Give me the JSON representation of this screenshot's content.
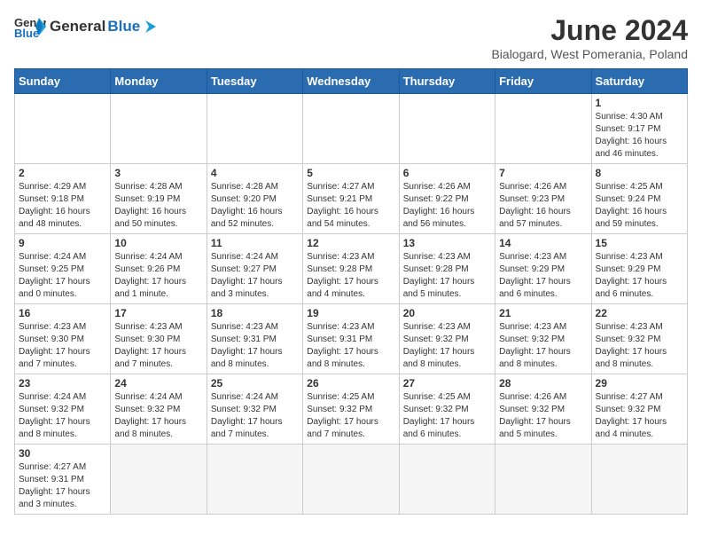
{
  "header": {
    "logo_general": "General",
    "logo_blue": "Blue",
    "month_year": "June 2024",
    "location": "Bialogard, West Pomerania, Poland"
  },
  "days_of_week": [
    "Sunday",
    "Monday",
    "Tuesday",
    "Wednesday",
    "Thursday",
    "Friday",
    "Saturday"
  ],
  "weeks": [
    [
      {
        "date": "",
        "info": ""
      },
      {
        "date": "",
        "info": ""
      },
      {
        "date": "",
        "info": ""
      },
      {
        "date": "",
        "info": ""
      },
      {
        "date": "",
        "info": ""
      },
      {
        "date": "",
        "info": ""
      },
      {
        "date": "1",
        "info": "Sunrise: 4:30 AM\nSunset: 9:17 PM\nDaylight: 16 hours\nand 46 minutes."
      }
    ],
    [
      {
        "date": "2",
        "info": "Sunrise: 4:29 AM\nSunset: 9:18 PM\nDaylight: 16 hours\nand 48 minutes."
      },
      {
        "date": "3",
        "info": "Sunrise: 4:28 AM\nSunset: 9:19 PM\nDaylight: 16 hours\nand 50 minutes."
      },
      {
        "date": "4",
        "info": "Sunrise: 4:28 AM\nSunset: 9:20 PM\nDaylight: 16 hours\nand 52 minutes."
      },
      {
        "date": "5",
        "info": "Sunrise: 4:27 AM\nSunset: 9:21 PM\nDaylight: 16 hours\nand 54 minutes."
      },
      {
        "date": "6",
        "info": "Sunrise: 4:26 AM\nSunset: 9:22 PM\nDaylight: 16 hours\nand 56 minutes."
      },
      {
        "date": "7",
        "info": "Sunrise: 4:26 AM\nSunset: 9:23 PM\nDaylight: 16 hours\nand 57 minutes."
      },
      {
        "date": "8",
        "info": "Sunrise: 4:25 AM\nSunset: 9:24 PM\nDaylight: 16 hours\nand 59 minutes."
      }
    ],
    [
      {
        "date": "9",
        "info": "Sunrise: 4:24 AM\nSunset: 9:25 PM\nDaylight: 17 hours\nand 0 minutes."
      },
      {
        "date": "10",
        "info": "Sunrise: 4:24 AM\nSunset: 9:26 PM\nDaylight: 17 hours\nand 1 minute."
      },
      {
        "date": "11",
        "info": "Sunrise: 4:24 AM\nSunset: 9:27 PM\nDaylight: 17 hours\nand 3 minutes."
      },
      {
        "date": "12",
        "info": "Sunrise: 4:23 AM\nSunset: 9:28 PM\nDaylight: 17 hours\nand 4 minutes."
      },
      {
        "date": "13",
        "info": "Sunrise: 4:23 AM\nSunset: 9:28 PM\nDaylight: 17 hours\nand 5 minutes."
      },
      {
        "date": "14",
        "info": "Sunrise: 4:23 AM\nSunset: 9:29 PM\nDaylight: 17 hours\nand 6 minutes."
      },
      {
        "date": "15",
        "info": "Sunrise: 4:23 AM\nSunset: 9:29 PM\nDaylight: 17 hours\nand 6 minutes."
      }
    ],
    [
      {
        "date": "16",
        "info": "Sunrise: 4:23 AM\nSunset: 9:30 PM\nDaylight: 17 hours\nand 7 minutes."
      },
      {
        "date": "17",
        "info": "Sunrise: 4:23 AM\nSunset: 9:30 PM\nDaylight: 17 hours\nand 7 minutes."
      },
      {
        "date": "18",
        "info": "Sunrise: 4:23 AM\nSunset: 9:31 PM\nDaylight: 17 hours\nand 8 minutes."
      },
      {
        "date": "19",
        "info": "Sunrise: 4:23 AM\nSunset: 9:31 PM\nDaylight: 17 hours\nand 8 minutes."
      },
      {
        "date": "20",
        "info": "Sunrise: 4:23 AM\nSunset: 9:32 PM\nDaylight: 17 hours\nand 8 minutes."
      },
      {
        "date": "21",
        "info": "Sunrise: 4:23 AM\nSunset: 9:32 PM\nDaylight: 17 hours\nand 8 minutes."
      },
      {
        "date": "22",
        "info": "Sunrise: 4:23 AM\nSunset: 9:32 PM\nDaylight: 17 hours\nand 8 minutes."
      }
    ],
    [
      {
        "date": "23",
        "info": "Sunrise: 4:24 AM\nSunset: 9:32 PM\nDaylight: 17 hours\nand 8 minutes."
      },
      {
        "date": "24",
        "info": "Sunrise: 4:24 AM\nSunset: 9:32 PM\nDaylight: 17 hours\nand 8 minutes."
      },
      {
        "date": "25",
        "info": "Sunrise: 4:24 AM\nSunset: 9:32 PM\nDaylight: 17 hours\nand 7 minutes."
      },
      {
        "date": "26",
        "info": "Sunrise: 4:25 AM\nSunset: 9:32 PM\nDaylight: 17 hours\nand 7 minutes."
      },
      {
        "date": "27",
        "info": "Sunrise: 4:25 AM\nSunset: 9:32 PM\nDaylight: 17 hours\nand 6 minutes."
      },
      {
        "date": "28",
        "info": "Sunrise: 4:26 AM\nSunset: 9:32 PM\nDaylight: 17 hours\nand 5 minutes."
      },
      {
        "date": "29",
        "info": "Sunrise: 4:27 AM\nSunset: 9:32 PM\nDaylight: 17 hours\nand 4 minutes."
      }
    ],
    [
      {
        "date": "30",
        "info": "Sunrise: 4:27 AM\nSunset: 9:31 PM\nDaylight: 17 hours\nand 3 minutes."
      },
      {
        "date": "",
        "info": ""
      },
      {
        "date": "",
        "info": ""
      },
      {
        "date": "",
        "info": ""
      },
      {
        "date": "",
        "info": ""
      },
      {
        "date": "",
        "info": ""
      },
      {
        "date": "",
        "info": ""
      }
    ]
  ]
}
